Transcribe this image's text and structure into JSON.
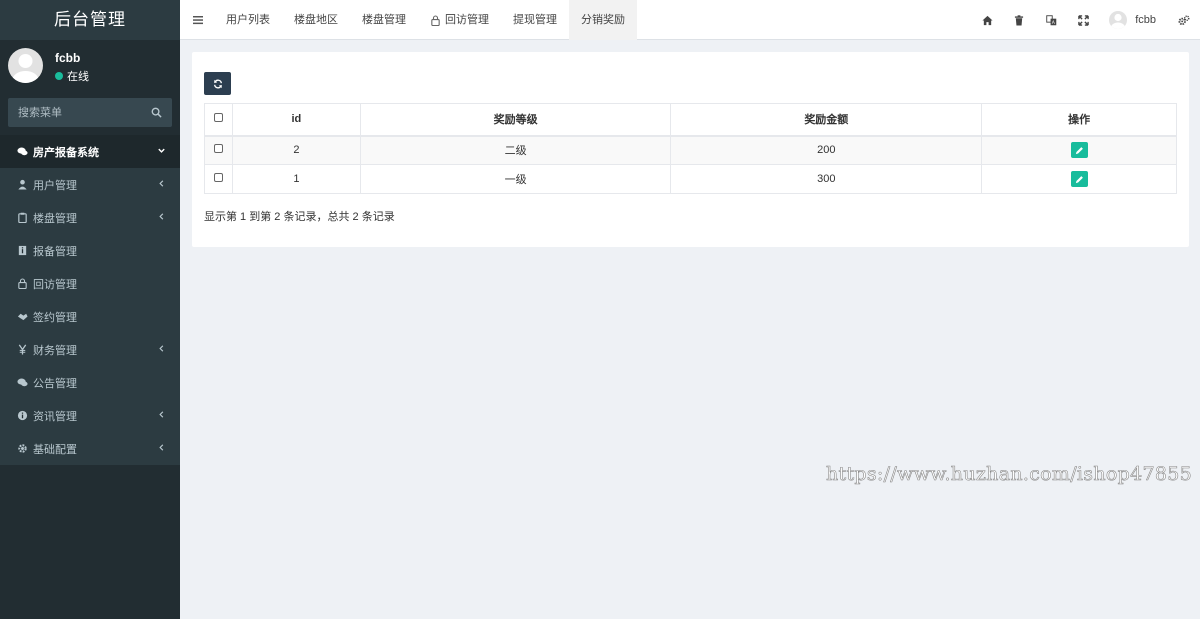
{
  "sidebar": {
    "brand": "后台管理",
    "user": {
      "name": "fcbb",
      "status": "在线"
    },
    "search": {
      "placeholder": "搜索菜单"
    },
    "menu_header": "房产报备系统",
    "items": [
      {
        "label": "用户管理",
        "icon": "user-icon",
        "expandable": true
      },
      {
        "label": "楼盘管理",
        "icon": "clipboard-icon",
        "expandable": true
      },
      {
        "label": "报备管理",
        "icon": "info-book-icon",
        "expandable": false
      },
      {
        "label": "回访管理",
        "icon": "lock-icon",
        "expandable": false
      },
      {
        "label": "签约管理",
        "icon": "handshake-icon",
        "expandable": false
      },
      {
        "label": "财务管理",
        "icon": "yen-icon",
        "expandable": true
      },
      {
        "label": "公告管理",
        "icon": "comments-icon",
        "expandable": false
      },
      {
        "label": "资讯管理",
        "icon": "info-circle-icon",
        "expandable": true
      },
      {
        "label": "基础配置",
        "icon": "gear-icon",
        "expandable": true
      }
    ]
  },
  "navbar": {
    "tabs": [
      {
        "label": "用户列表"
      },
      {
        "label": "楼盘地区"
      },
      {
        "label": "楼盘管理"
      },
      {
        "label": "回访管理",
        "icon": "lock-icon"
      },
      {
        "label": "提现管理"
      },
      {
        "label": "分销奖励",
        "active": true
      }
    ],
    "right_icons": [
      "home-icon",
      "trash-icon",
      "translate-icon",
      "fullscreen-icon"
    ],
    "user_name": "fcbb",
    "settings_icon": "cogs-icon"
  },
  "table": {
    "columns": [
      "id",
      "奖励等级",
      "奖励金额",
      "操作"
    ],
    "rows": [
      {
        "id": "2",
        "level": "二级",
        "amount": "200"
      },
      {
        "id": "1",
        "level": "一级",
        "amount": "300"
      }
    ],
    "summary": "显示第 1 到第 2 条记录，总共 2 条记录"
  },
  "watermark": "https://www.huzhan.com/ishop47855",
  "colors": {
    "sidebar_bg": "#222d32",
    "accent_green": "#18bc9c",
    "refresh_btn": "#2c3e50",
    "online": "#1abc9c"
  }
}
